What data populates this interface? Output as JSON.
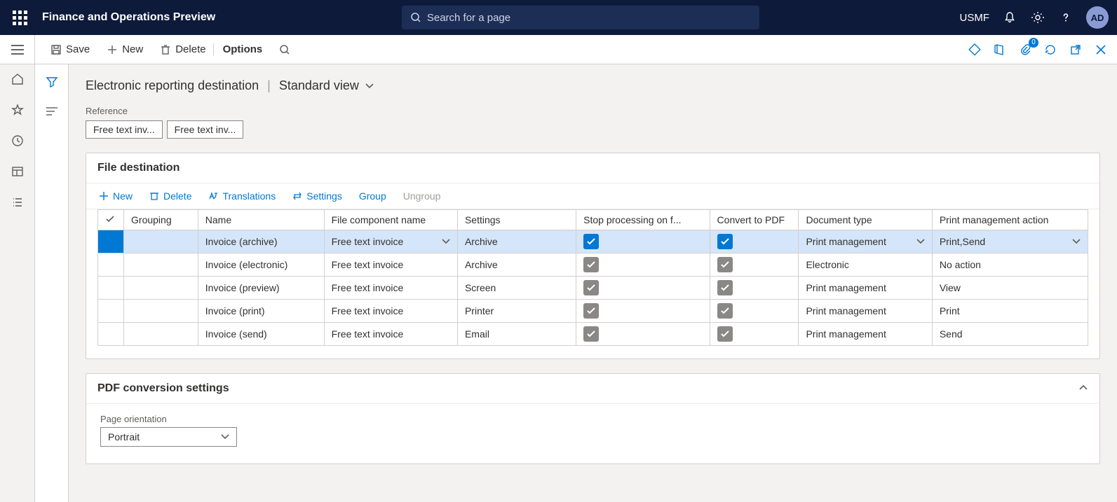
{
  "header": {
    "app_title": "Finance and Operations Preview",
    "search_placeholder": "Search for a page",
    "entity": "USMF",
    "avatar": "AD",
    "attachments_count": "0"
  },
  "actions": {
    "save": "Save",
    "new": "New",
    "delete": "Delete",
    "options": "Options"
  },
  "breadcrumb": {
    "title": "Electronic reporting destination",
    "view": "Standard view"
  },
  "reference": {
    "label": "Reference",
    "pill1": "Free text inv...",
    "pill2": "Free text inv..."
  },
  "fileDest": {
    "title": "File destination",
    "toolbar": {
      "new": "New",
      "delete": "Delete",
      "translations": "Translations",
      "settings": "Settings",
      "group": "Group",
      "ungroup": "Ungroup"
    },
    "columns": {
      "grouping": "Grouping",
      "name": "Name",
      "file_component": "File component name",
      "settings": "Settings",
      "stop": "Stop processing on f...",
      "convert": "Convert to PDF",
      "doctype": "Document type",
      "pma": "Print management action"
    },
    "rows": [
      {
        "name": "Invoice (archive)",
        "file_component": "Free text invoice",
        "settings": "Archive",
        "stop": true,
        "convert": true,
        "doctype": "Print management",
        "pma": "Print,Send",
        "selected": true,
        "blue_check": true
      },
      {
        "name": "Invoice (electronic)",
        "file_component": "Free text invoice",
        "settings": "Archive",
        "stop": true,
        "convert": true,
        "doctype": "Electronic",
        "pma": "No action"
      },
      {
        "name": "Invoice (preview)",
        "file_component": "Free text invoice",
        "settings": "Screen",
        "stop": true,
        "convert": true,
        "doctype": "Print management",
        "pma": "View"
      },
      {
        "name": "Invoice (print)",
        "file_component": "Free text invoice",
        "settings": "Printer",
        "stop": true,
        "convert": true,
        "doctype": "Print management",
        "pma": "Print"
      },
      {
        "name": "Invoice (send)",
        "file_component": "Free text invoice",
        "settings": "Email",
        "stop": true,
        "convert": true,
        "doctype": "Print management",
        "pma": "Send"
      }
    ]
  },
  "pdf": {
    "title": "PDF conversion settings",
    "orientation_label": "Page orientation",
    "orientation_value": "Portrait"
  }
}
